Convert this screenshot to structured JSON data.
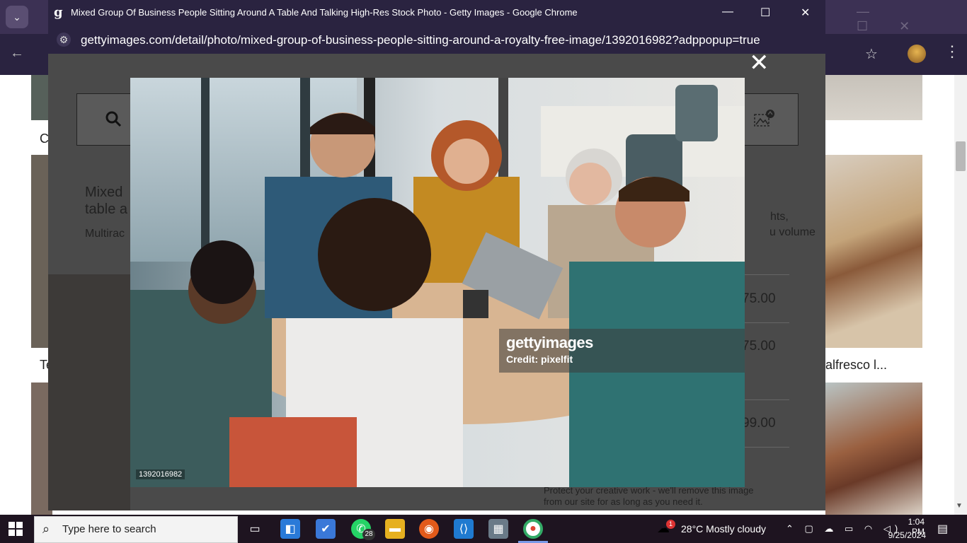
{
  "background_browser": {
    "tab_search_icon": "chevron-down-icon",
    "back_icon": "arrow-left-icon",
    "bookmark_icon": "star-icon",
    "menu_icon": "kebab-menu-icon"
  },
  "background_page": {
    "partial_text_left_1": "C",
    "partial_text_left_2": "Te",
    "partial_text_right": "alfresco l..."
  },
  "popup_window": {
    "title": "Mixed Group Of Business People Sitting Around A Table And Talking High-Res Stock Photo - Getty Images - Google Chrome",
    "favicon_letter": "g",
    "url": "gettyimages.com/detail/photo/mixed-group-of-business-people-sitting-around-a-royalty-free-image/1392016982?adppopup=true",
    "minimize": "—",
    "maximize": "☐",
    "close": "✕"
  },
  "dimmed_page": {
    "title": "Mixed group of business people sitting around a table and talking",
    "title_line_1": "Mixed",
    "title_line_2": "table a",
    "subtitle": "Multirac",
    "rights_partial": "hts,",
    "volume_partial": "u volume",
    "prices": [
      "75.00",
      "75.00",
      "99.00"
    ],
    "protect_text": "Protect your creative work - we'll remove this image from our site for as long as you need it."
  },
  "photo": {
    "watermark_brand": "gettyimages",
    "credit": "Credit: pixelfit",
    "image_id": "1392016982",
    "close_label": "✕"
  },
  "taskbar": {
    "search_placeholder": "Type here to search",
    "whatsapp_badge": "28",
    "weather_badge": "1",
    "weather": "28°C  Mostly cloudy",
    "time": "1:04 PM",
    "date": "9/25/2024"
  }
}
